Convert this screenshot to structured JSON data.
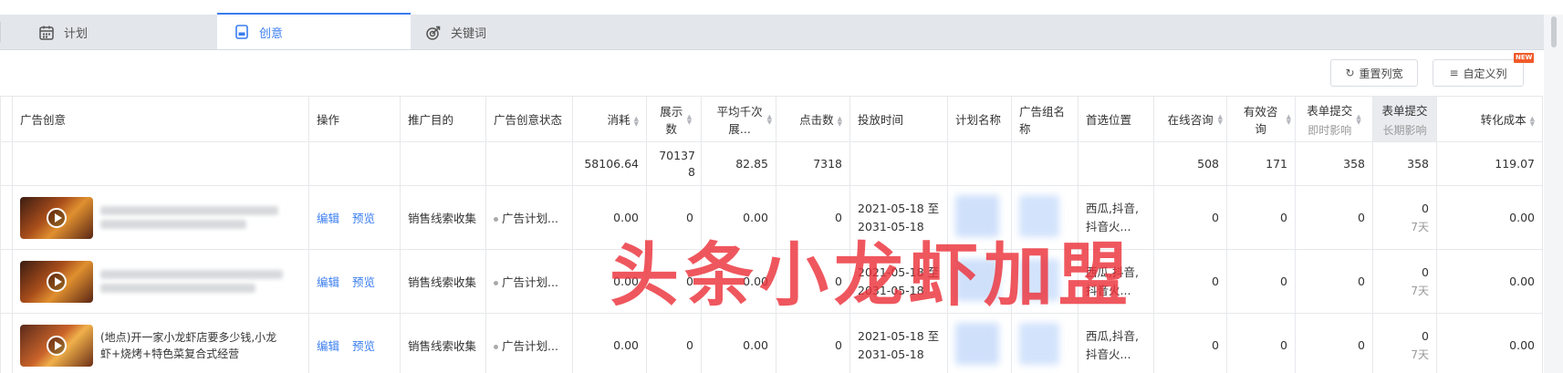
{
  "tabs": [
    {
      "label": "计划",
      "icon": "calendar-icon"
    },
    {
      "label": "创意",
      "icon": "creative-icon"
    },
    {
      "label": "关键词",
      "icon": "keyword-icon"
    }
  ],
  "toolbar": {
    "reset_label": "重置列宽",
    "custom_label": "自定义列",
    "new_badge": "NEW"
  },
  "columns": {
    "creative": "广告创意",
    "action": "操作",
    "purpose": "推广目的",
    "status": "广告创意状态",
    "cost": "消耗",
    "impressions": "展示数",
    "cpm": "平均千次展...",
    "clicks": "点击数",
    "schedule": "投放时间",
    "plan": "计划名称",
    "group": "广告组名称",
    "placement": "首选位置",
    "online_consult": "在线咨询",
    "valid_consult": "有效咨询",
    "form_instant": "表单提交",
    "form_instant_sub": "即时影响",
    "form_long": "表单提交",
    "form_long_sub": "长期影响",
    "conv_cost": "转化成本"
  },
  "summary": {
    "cost": "58106.64",
    "impressions": "701378",
    "cpm": "82.85",
    "clicks": "7318",
    "online_consult": "508",
    "valid_consult": "171",
    "form_instant": "358",
    "form_long": "358",
    "conv_cost": "119.07"
  },
  "rows": [
    {
      "title": "",
      "edit": "编辑",
      "preview": "预览",
      "purpose": "销售线索收集",
      "status": "广告计划...",
      "cost": "0.00",
      "impressions": "0",
      "cpm": "0.00",
      "clicks": "0",
      "time_start": "2021-05-18 至",
      "time_end": "2031-05-18",
      "placement_1": "西瓜,抖音,",
      "placement_2": "抖音火...",
      "online_consult": "0",
      "valid_consult": "0",
      "form_instant": "0",
      "form_long": "0",
      "form_long_sub": "7天",
      "conv_cost": "0.00"
    },
    {
      "title": "",
      "edit": "编辑",
      "preview": "预览",
      "purpose": "销售线索收集",
      "status": "广告计划...",
      "cost": "0.00",
      "impressions": "0",
      "cpm": "0.00",
      "clicks": "0",
      "time_start": "2021-05-18 至",
      "time_end": "2031-05-18",
      "placement_1": "西瓜,抖音,",
      "placement_2": "抖音火...",
      "online_consult": "0",
      "valid_consult": "0",
      "form_instant": "0",
      "form_long": "0",
      "form_long_sub": "7天",
      "conv_cost": "0.00"
    },
    {
      "title": "(地点)开一家小龙虾店要多少钱,小龙虾+烧烤+特色菜复合式经营",
      "edit": "编辑",
      "preview": "预览",
      "purpose": "销售线索收集",
      "status": "广告计划...",
      "cost": "0.00",
      "impressions": "0",
      "cpm": "0.00",
      "clicks": "0",
      "time_start": "2021-05-18 至",
      "time_end": "2031-05-18",
      "placement_1": "西瓜,抖音,",
      "placement_2": "抖音火...",
      "online_consult": "0",
      "valid_consult": "0",
      "form_instant": "0",
      "form_long": "0",
      "form_long_sub": "7天",
      "conv_cost": "0.00"
    }
  ],
  "watermark": "头条小龙虾加盟"
}
